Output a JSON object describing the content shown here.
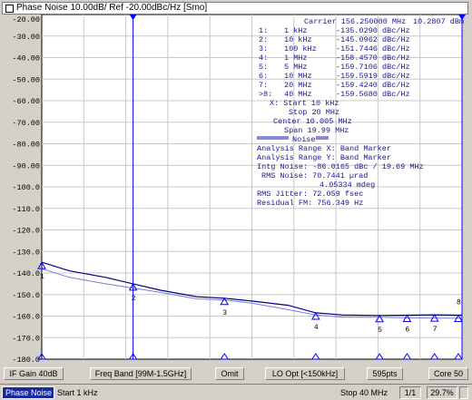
{
  "title": "Phase Noise 10.00dB/ Ref -20.00dBc/Hz [Smo]",
  "carrier": "Carrier 156.250000 MHz",
  "carrier_level": "10.2807 dBm",
  "y_ticks": [
    "-20.00",
    "-30.00",
    "-40.00",
    "-50.00",
    "-60.00",
    "-70.00",
    "-80.00",
    "-90.00",
    "-100.0",
    "-110.0",
    "-120.0",
    "-130.0",
    "-140.0",
    "-150.0",
    "-160.0",
    "-170.0",
    "-180.0"
  ],
  "markers": [
    {
      "label": "1:",
      "freq": "1 kHz",
      "value": "-135.0290 dBc/Hz"
    },
    {
      "label": "2:",
      "freq": "10 kHz",
      "value": "-145.0962 dBc/Hz"
    },
    {
      "label": "3:",
      "freq": "100 kHz",
      "value": "-151.7446 dBc/Hz"
    },
    {
      "label": "4:",
      "freq": "1 MHz",
      "value": "-158.4570 dBc/Hz"
    },
    {
      "label": "5:",
      "freq": "5 MHz",
      "value": "-159.7106 dBc/Hz"
    },
    {
      "label": "6:",
      "freq": "10 MHz",
      "value": "-159.5919 dBc/Hz"
    },
    {
      "label": "7:",
      "freq": "20 MHz",
      "value": "-159.4240 dBc/Hz"
    },
    {
      "label": ">8:",
      "freq": "40 MHz",
      "value": "-159.5680 dBc/Hz"
    }
  ],
  "x_info": {
    "start": "X: Start 10 kHz",
    "stop": "Stop 20 MHz",
    "center": "Center 10.005 MHz",
    "span": "Span 19.99 MHz"
  },
  "noise": {
    "header": "Noise",
    "range_x": "Analysis Range X: Band Marker",
    "range_y": "Analysis Range Y: Band Marker",
    "intg": "Intg Noise: -86.0165 dBc / 19.69 MHz",
    "rms": "RMS Noise: 70.7441 µrad",
    "rms2": "4.05334 mdeg",
    "jitter": "RMS Jitter: 72.059 fsec",
    "residual": "Residual FM: 756.349 Hz"
  },
  "marker_tags": [
    "1",
    "2",
    "3",
    "4",
    "5",
    "6",
    "7",
    "8"
  ],
  "chart_data": {
    "type": "line",
    "xlabel": "",
    "ylabel": "",
    "ylim": [
      -180,
      -20
    ],
    "x_scale": "log",
    "x_range": [
      "1 kHz",
      "40 MHz"
    ],
    "series": [
      {
        "x": [
          1,
          2,
          5,
          10,
          20,
          50,
          100,
          200,
          500,
          1000,
          2000,
          5000,
          10000,
          20000,
          40000
        ],
        "values": [
          -135,
          -139,
          -142,
          -145,
          -148,
          -151,
          -151.7,
          -153,
          -155,
          -158.5,
          -159.5,
          -159.7,
          -159.6,
          -159.4,
          -159.6
        ]
      },
      {
        "x": [
          1,
          2,
          5,
          10,
          20,
          50,
          100,
          200,
          500,
          1000,
          2000,
          5000,
          10000,
          20000,
          40000
        ],
        "values": [
          -138,
          -142,
          -145,
          -147,
          -149,
          -152,
          -152.5,
          -154,
          -157,
          -159.5,
          -160.5,
          -160.5,
          -160.8,
          -160.9,
          -161
        ]
      }
    ],
    "x_unit": "kHz",
    "colors": {
      "trace1": "#00008b",
      "trace2": "#7b7bd6",
      "marker": "#0000ff",
      "grid": "#c8c8c8"
    }
  },
  "status": {
    "if_gain": "IF Gain 40dB",
    "freq_band": "Freq Band [99M-1.5GHz]",
    "omit": "Omit",
    "lo_opt": "LO Opt [<150kHz]",
    "points": "595pts",
    "core": "Core 50"
  },
  "bottom": {
    "meas": "Phase Noise",
    "start": "Start 1 kHz",
    "stop": "Stop 40 MHz",
    "page": "1/1",
    "pct": "29.7%"
  }
}
